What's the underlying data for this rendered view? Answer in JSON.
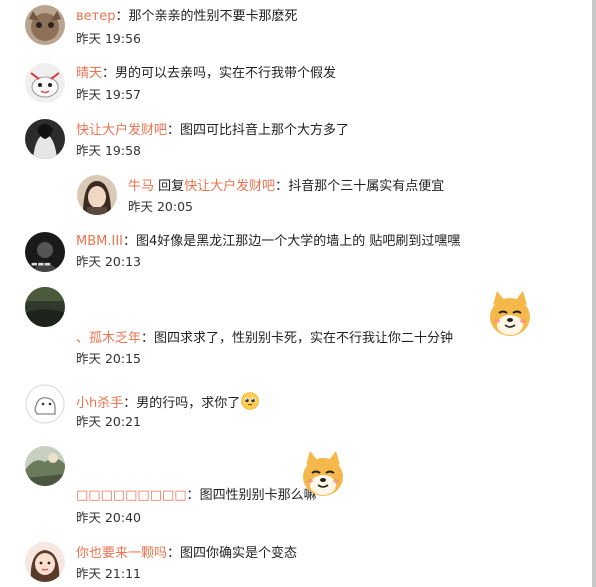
{
  "comments": [
    {
      "name": "ветер",
      "sep": "：",
      "text": "那个亲亲的性别不要卡那麽死",
      "time": "昨天 19:56"
    },
    {
      "name": "晴天",
      "sep": "：",
      "text": "男的可以去亲吗，实在不行我带个假发",
      "time": "昨天 19:57"
    },
    {
      "name": "快让大户发财吧",
      "sep": "：",
      "text": "图四可比抖音上那个大方多了",
      "time": "昨天 19:58"
    },
    {
      "name": "牛马",
      "reply_word": " 回复",
      "reply_to": "快让大户发财吧",
      "sep": "：",
      "text": "抖音那个三十属实有点便宜",
      "time": "昨天 20:05"
    },
    {
      "name": "MBM.III",
      "sep": "：",
      "text": "图4好像是黑龙江那边一个大学的墙上的 贴吧刷到过嘿嘿",
      "time": "昨天 20:13"
    },
    {
      "name_prefix": "、",
      "name": "孤木乏年",
      "sep": "：",
      "text": "图四求求了，性别别卡死，实在不行我让你二十分钟",
      "time": "昨天 20:15"
    },
    {
      "name": "小h杀手",
      "sep": "：",
      "text": "男的行吗，求你了",
      "time": "昨天 20:21"
    },
    {
      "name": "□□□□□□□□□",
      "sep": "：",
      "text": "图四性别别卡那么嘛",
      "time": "昨天 20:40"
    },
    {
      "name": "你也要来一颗吗",
      "sep": "：",
      "text": "图四你确实是个变态",
      "time": "昨天 21:11"
    }
  ],
  "icons": {
    "shiba_emoji": "doge-shiba-emoji",
    "pleading_emoji": "pleading-face-emoji"
  },
  "colors": {
    "username": "#eb7350",
    "text": "#222222",
    "timestamp": "#333333"
  }
}
